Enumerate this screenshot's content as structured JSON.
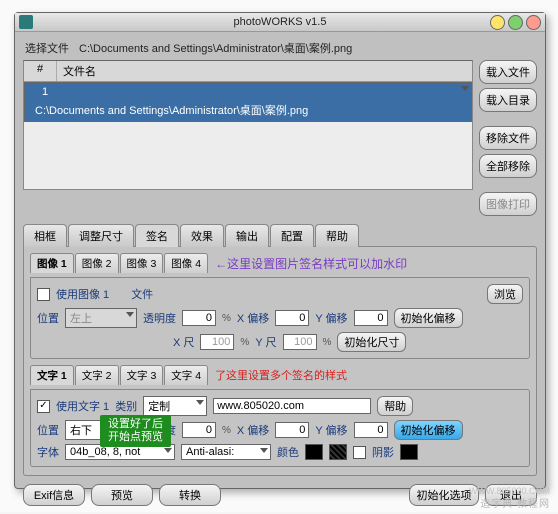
{
  "window": {
    "title": "photoWORKS v1.5"
  },
  "pathrow": {
    "label": "选择文件",
    "path": "C:\\Documents and Settings\\Administrator\\桌面\\案例.png"
  },
  "filelist": {
    "col1": "#",
    "col2": "文件名",
    "rows": [
      {
        "n": "1",
        "name": "C:\\Documents and Settings\\Administrator\\桌面\\案例.png"
      }
    ]
  },
  "sidebar": {
    "btns": [
      "载入文件",
      "载入目录",
      "移除文件",
      "全部移除",
      "图像打印"
    ]
  },
  "maintabs": [
    "相框",
    "调整尺寸",
    "签名",
    "效果",
    "输出",
    "配置",
    "帮助"
  ],
  "maintab_active": 2,
  "img_section": {
    "tabs": [
      "图像 1",
      "图像 2",
      "图像 3",
      "图像 4"
    ],
    "hint": "←这里设置图片签名样式可以加水印",
    "use": "使用图像 1",
    "file": "文件",
    "browse": "浏览",
    "pos": "位置",
    "pos_val": "左上",
    "opacity": "透明度",
    "opacity_val": "0",
    "pct": "%",
    "xoff": "X 偏移",
    "xoff_val": "0",
    "yoff": "Y 偏移",
    "yoff_val": "0",
    "initoff": "初始化偏移",
    "xscale": "X 尺",
    "xscale_val": "100",
    "yscale": "Y 尺",
    "yscale_val": "100",
    "initsize": "初始化尺寸"
  },
  "txt_section": {
    "tabs": [
      "文字 1",
      "文字 2",
      "文字 3",
      "文字 4"
    ],
    "hint": "了这里设置多个签名的样式",
    "use": "使用文字 1",
    "kind": "类别",
    "kind_val": "定制",
    "text_val": "www.805020.com",
    "help": "帮助",
    "pos": "位置",
    "pos_val": "右下",
    "opacity": "透明度",
    "opacity_val": "0",
    "pct": "%",
    "xoff": "X 偏移",
    "xoff_val": "0",
    "yoff": "Y 偏移",
    "yoff_val": "0",
    "initoff": "初始化偏移",
    "font": "字体",
    "font_val": "04b_08, 8, not",
    "aa": "Anti-alasi:",
    "color": "颜色",
    "shadow": "阴影"
  },
  "greenbox": {
    "l1": "设置好了后",
    "l2": "开始点预览"
  },
  "bottom": {
    "exif": "Exif信息",
    "preview": "预览",
    "convert": "转换",
    "initopt": "初始化选项",
    "exit": "退出"
  },
  "wm1": "造字典 教程网",
  "wm2": "WWW.805020.COM"
}
